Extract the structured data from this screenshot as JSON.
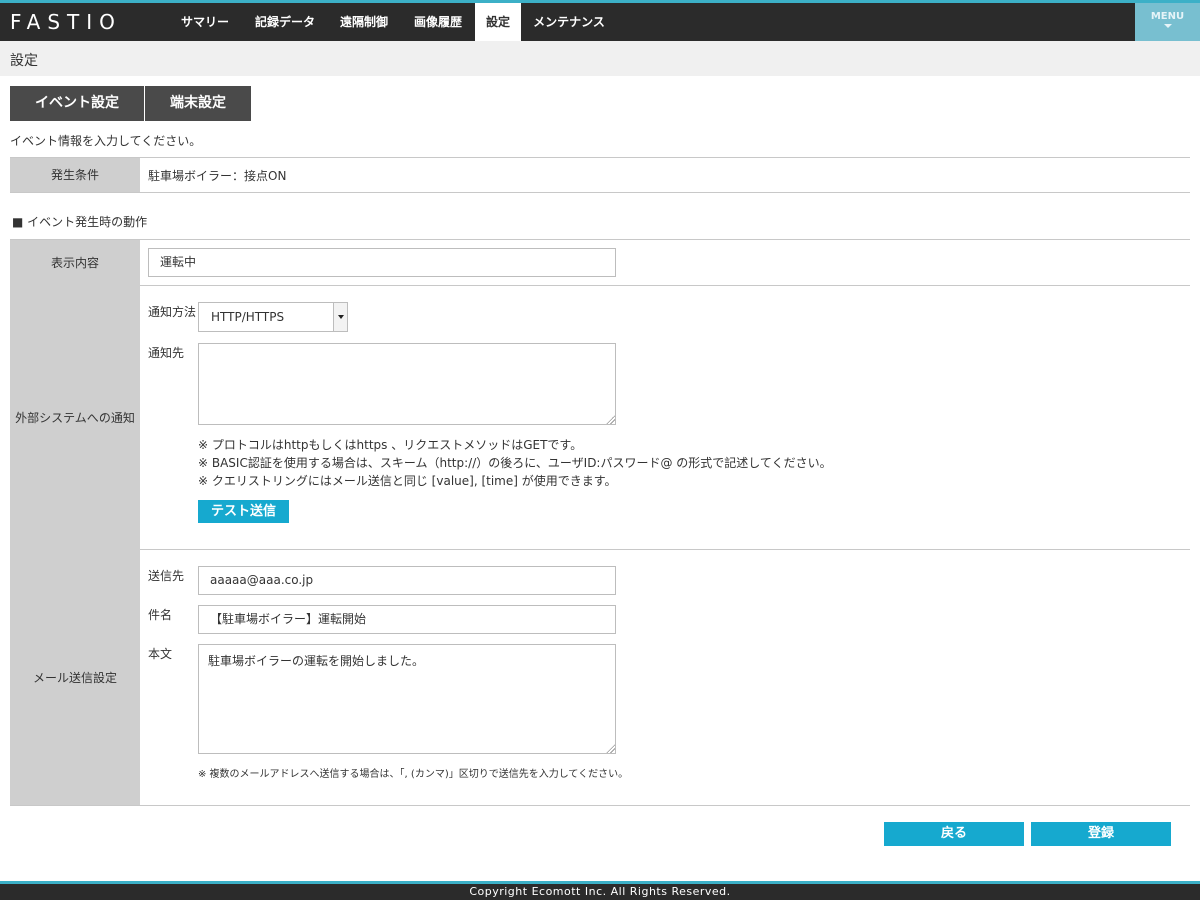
{
  "nav": {
    "logo": "FASTIO",
    "items": [
      {
        "label": "サマリー"
      },
      {
        "label": "記録データ"
      },
      {
        "label": "遠隔制御"
      },
      {
        "label": "画像履歴"
      },
      {
        "label": "設定",
        "active": true
      },
      {
        "label": "メンテナンス"
      }
    ],
    "menu_label": "MENU"
  },
  "page_title": "設定",
  "tabs": [
    {
      "label": "イベント設定"
    },
    {
      "label": "端末設定"
    }
  ],
  "intro_text": "イベント情報を入力してください。",
  "condition": {
    "label": "発生条件",
    "value": "駐車場ボイラー：接点ON"
  },
  "action_heading": "■ イベント発生時の動作",
  "display": {
    "label": "表示内容",
    "value": "運転中"
  },
  "external": {
    "label": "外部システムへの通知",
    "method_label": "通知方法",
    "method_value": "HTTP/HTTPS",
    "dest_label": "通知先",
    "dest_value": "",
    "notes": [
      "※ プロトコルはhttpもしくはhttps 、リクエストメソッドはGETです。",
      "※ BASIC認証を使用する場合は、スキーム（http://）の後ろに、ユーザID:パスワード@ の形式で記述してください。",
      "※ クエリストリングにはメール送信と同じ [value], [time] が使用できます。"
    ],
    "test_button": "テスト送信"
  },
  "mail": {
    "label": "メール送信設定",
    "to_label": "送信先",
    "to_value": "aaaaa@aaa.co.jp",
    "subject_label": "件名",
    "subject_value": "【駐車場ボイラー】運転開始",
    "body_label": "本文",
    "body_value": "駐車場ボイラーの運転を開始しました。",
    "note": "※ 複数のメールアドレスへ送信する場合は、「, (カンマ)」区切りで送信先を入力してください。"
  },
  "actions": {
    "back": "戻る",
    "register": "登録"
  },
  "footer": "Copyright Ecomott Inc. All Rights Reserved.",
  "colors": {
    "accent": "#16a9cf",
    "nav_bg": "#2b2b2b",
    "label_bg": "#cfcfcf",
    "tab_bg": "#4a4a4a"
  }
}
